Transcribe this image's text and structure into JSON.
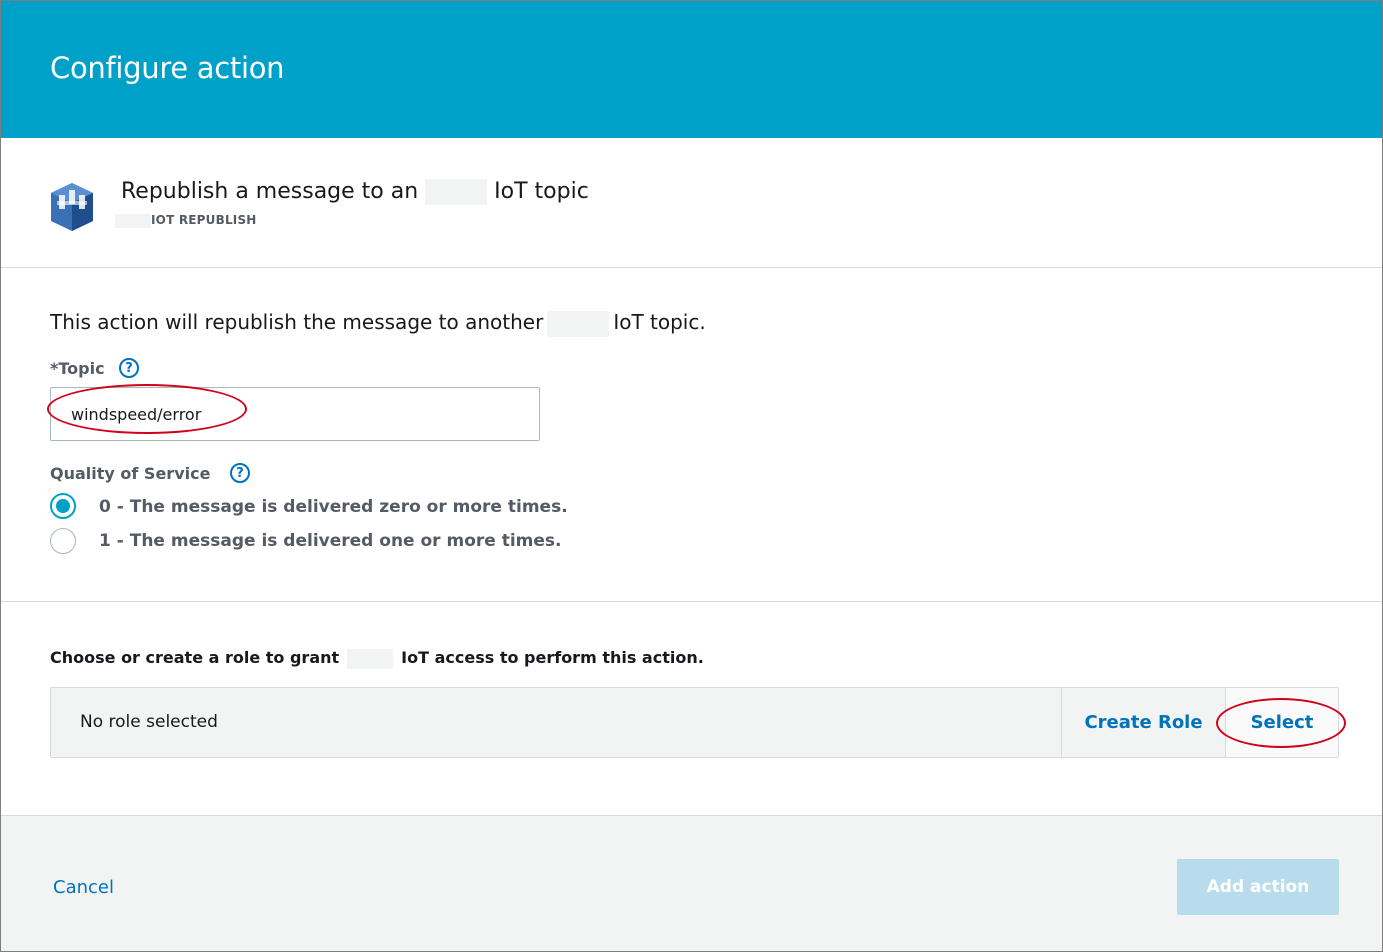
{
  "dialog": {
    "title": "Configure action"
  },
  "action": {
    "title_prefix": "Republish a message to an",
    "title_suffix": "IoT topic",
    "subtitle": "IOT REPUBLISH",
    "icon": "iot-republish-icon"
  },
  "form": {
    "description_prefix": "This action will republish the message to another",
    "description_suffix": "IoT topic.",
    "topic": {
      "label": "*Topic",
      "value": "windspeed/error"
    },
    "qos": {
      "label": "Quality of Service",
      "options": [
        {
          "label": "0 - The message is delivered zero or more times.",
          "selected": true
        },
        {
          "label": "1 - The message is delivered one or more times.",
          "selected": false
        }
      ]
    },
    "help_glyph": "?"
  },
  "role": {
    "prompt_prefix": "Choose or create a role to grant",
    "prompt_suffix": "IoT access to perform this action.",
    "status": "No role selected",
    "create_label": "Create Role",
    "select_label": "Select"
  },
  "footer": {
    "cancel_label": "Cancel",
    "add_label": "Add action"
  },
  "colors": {
    "header": "#00a1c9",
    "link": "#0073bb",
    "annotation": "#d0021b",
    "disabled_button": "#b8dcec"
  }
}
